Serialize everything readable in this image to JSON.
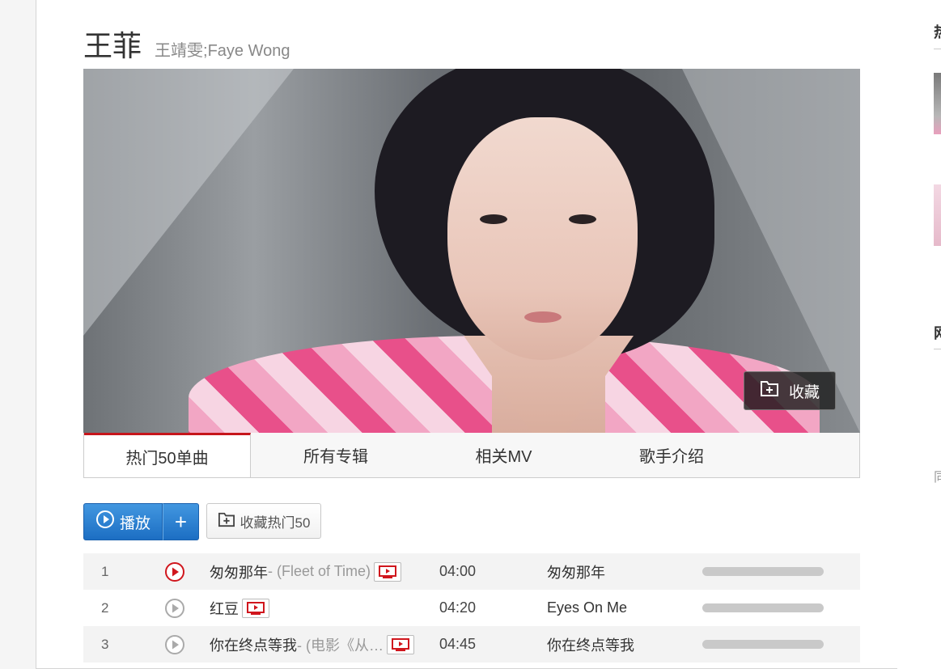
{
  "artist": {
    "name": "王菲",
    "alias": "王靖雯;Faye Wong"
  },
  "banner": {
    "favorite_label": "收藏"
  },
  "tabs": [
    {
      "label": "热门50单曲",
      "active": true
    },
    {
      "label": "所有专辑",
      "active": false
    },
    {
      "label": "相关MV",
      "active": false
    },
    {
      "label": "歌手介绍",
      "active": false
    }
  ],
  "actions": {
    "play_label": "播放",
    "add_label": "+",
    "collect_label": "收藏热门50"
  },
  "songs": [
    {
      "index": "1",
      "title": "匆匆那年",
      "subtitle": " - (Fleet of Time)",
      "has_mv": true,
      "duration": "04:00",
      "album": "匆匆那年",
      "playing": true
    },
    {
      "index": "2",
      "title": "红豆",
      "subtitle": "",
      "has_mv": true,
      "duration": "04:20",
      "album": "Eyes On Me",
      "playing": false
    },
    {
      "index": "3",
      "title": "你在终点等我",
      "subtitle": " - (电影《从…",
      "has_mv": true,
      "duration": "04:45",
      "album": "你在终点等我",
      "playing": false
    }
  ],
  "sidebar": {
    "heading_1": "热",
    "heading_2": "网",
    "text_1": "同"
  },
  "colors": {
    "accent_red": "#c6151b",
    "play_blue": "#2a7fd0"
  }
}
